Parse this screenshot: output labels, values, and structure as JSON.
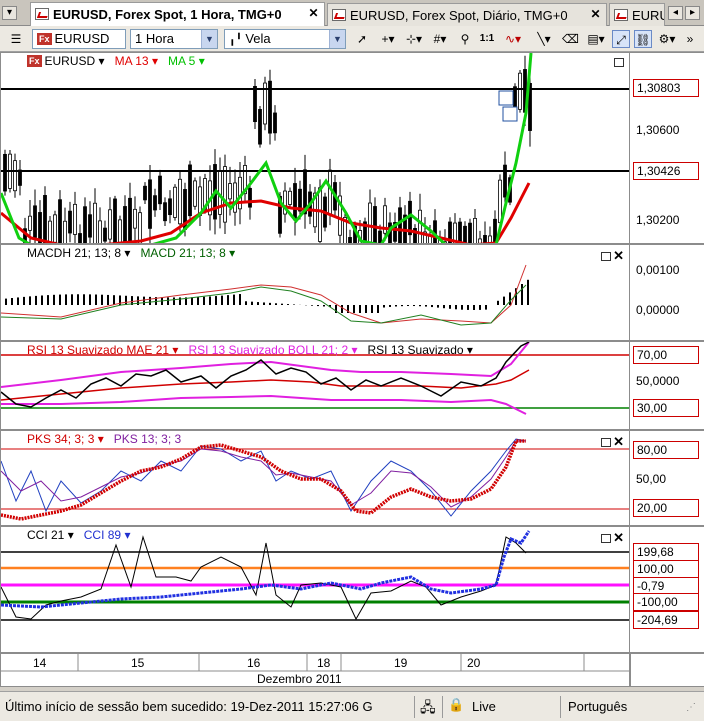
{
  "tabs": [
    {
      "label": "EURUSD, Forex Spot, 1 Hora, TMG+0"
    },
    {
      "label": "EURUSD, Forex Spot, Diário, TMG+0"
    },
    {
      "label": "EURUS"
    }
  ],
  "toolbar": {
    "symbol_badge": "Fx",
    "symbol": "EURUSD",
    "period": "1 Hora",
    "chart_style": "Vela",
    "zoom_label": "1:1",
    "icons": [
      "cursor-icon",
      "crosshair-icon",
      "grid-icon",
      "zoom-icon",
      "indicator-icon",
      "line-tool-icon",
      "eraser-icon",
      "template-icon"
    ]
  },
  "price_panel": {
    "legend": {
      "symbol": "EURUSD",
      "ma13": "MA 13",
      "ma5": "MA 5"
    },
    "axis_ticks": [
      "1,30600",
      "1,30200"
    ],
    "level_boxes": [
      "1,30803",
      "1,30426"
    ],
    "colors": {
      "ma13": "#e00000",
      "ma5": "#00d000",
      "level": "#000000",
      "box": "#c00000"
    }
  },
  "macd_panel": {
    "legend": {
      "hist": "MACDH 21; 13; 8",
      "line": "MACD 21; 13; 8"
    },
    "axis_ticks": [
      "0,00100",
      "0,00000"
    ]
  },
  "rsi_panel": {
    "legend": {
      "a": "RSI 13 Suavizado MAE 21",
      "b": "RSI 13 Suavizado BOLL 21; 2",
      "c": "RSI 13 Suavizado"
    },
    "axis_mid": "50,0000",
    "level_boxes": [
      "70,00",
      "30,00"
    ]
  },
  "pks_panel": {
    "legend": {
      "a": "PKS 34; 3; 3",
      "b": "PKS 13; 3; 3"
    },
    "axis_mid": "50,00",
    "level_boxes": [
      "80,00",
      "20,00"
    ]
  },
  "cci_panel": {
    "legend": {
      "a": "CCI 21",
      "b": "CCI 89"
    },
    "level_boxes": [
      "199,68",
      "100,00",
      "-0,79",
      "-100,00",
      "-204,69"
    ]
  },
  "xaxis": {
    "ticks": [
      "14",
      "15",
      "16",
      "18",
      "19",
      "20"
    ],
    "month_label": "Dezembro 2011"
  },
  "status": {
    "session_text": "Último início de sessão bem sucedido: 19-Dez-2011 15:27:06 G",
    "connection": "Live",
    "language": "Português"
  }
}
